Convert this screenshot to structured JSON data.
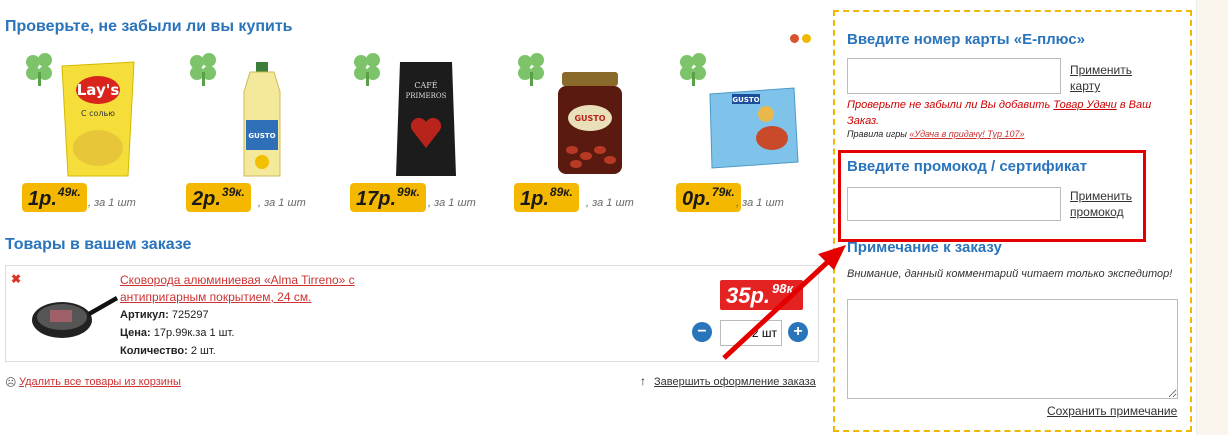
{
  "upsell": {
    "title": "Проверьте, не забыли ли вы купить",
    "dot_colors": [
      "#d9532c",
      "#f0b800"
    ],
    "products": [
      {
        "icon": "chips-icon",
        "rub": "1р.",
        "kop": "49к.",
        "per": ", за 1 шт"
      },
      {
        "icon": "oil-bottle-icon",
        "rub": "2р.",
        "kop": "39к.",
        "per": ", за 1 шт"
      },
      {
        "icon": "coffee-bag-icon",
        "rub": "17р.",
        "kop": "99к.",
        "per": ", за 1 шт"
      },
      {
        "icon": "beans-jar-icon",
        "rub": "1р.",
        "kop": "89к.",
        "per": ", за 1 шт"
      },
      {
        "icon": "frozen-pack-icon",
        "rub": "0р.",
        "kop": "79к.",
        "per": ", за 1 шт"
      }
    ]
  },
  "order": {
    "title": "Товары в вашем заказе",
    "item": {
      "name": "Сковорода алюминиевая «Alma Tirreno» с антипригарным покрытием, 24 см.",
      "article_label": "Артикул:",
      "article_value": "725297",
      "price_label": "Цена:",
      "price_value": "17р.99к.за 1 шт.",
      "qty_label": "Количество:",
      "qty_value": "2 шт.",
      "total_rub": "35р.",
      "total_kop": "98к.",
      "qty_input": "2 шт"
    },
    "clear_link": "Удалить все товары из корзины",
    "checkout_link": "Завершить оформление заказа"
  },
  "sidebar": {
    "card_title": "Введите номер карты «Е-плюс»",
    "card_apply": "Применить карту",
    "warn_text": "Проверьте не забыли ли Вы добавить",
    "warn_link": "Товар Удачи",
    "warn_tail": "в Ваш Заказ.",
    "rules_text": "Правила игры",
    "rules_link": "«Удача в придачу! Тур 107»",
    "promo_title": "Введите промокод / сертификат",
    "promo_apply": "Применить промокод",
    "note_title": "Примечание к заказу",
    "note_text": "Внимание, данный комментарий читает только экспедитор!",
    "save_note": "Сохранить примечание"
  },
  "colors": {
    "accent_blue": "#2a74bb",
    "price_yellow": "#f5b800",
    "price_red": "#e42222",
    "highlight_red": "#e50000",
    "panel_border": "#f0b800"
  }
}
